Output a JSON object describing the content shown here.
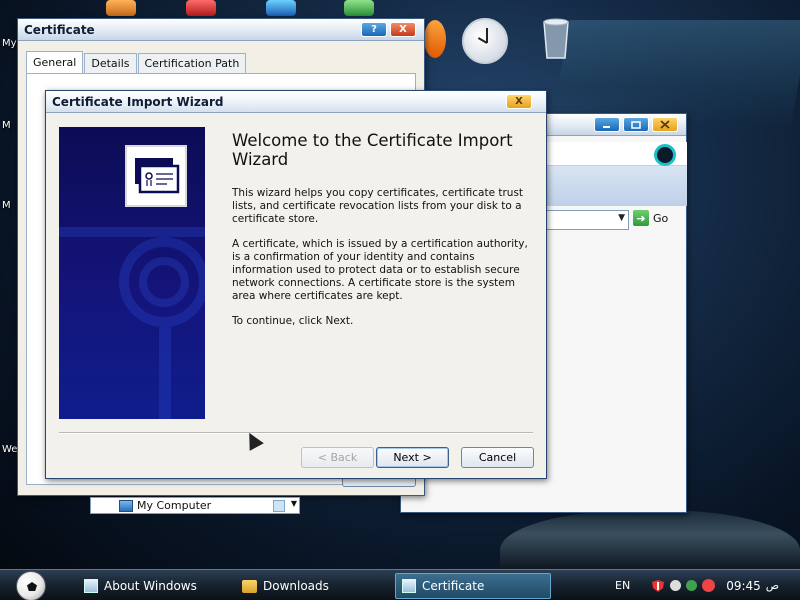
{
  "desktop": {
    "labels": [
      "My",
      "M",
      "M",
      "We"
    ]
  },
  "certificate_window": {
    "title": "Certificate",
    "help_btn": "?",
    "close_btn": "X",
    "tabs": [
      "General",
      "Details",
      "Certification Path"
    ],
    "active_tab": "General"
  },
  "explorer_window": {
    "go_label": "Go",
    "location": "My Computer"
  },
  "wizard": {
    "title": "Certificate Import Wizard",
    "close_btn": "X",
    "heading": "Welcome to the Certificate Import Wizard",
    "paragraphs": [
      "This wizard helps you copy certificates, certificate trust lists, and certificate revocation lists from your disk to a certificate store.",
      "A certificate, which is issued by a certification authority, is a confirmation of your identity and contains information used to protect data or to establish secure network connections. A certificate store is the system area where certificates are kept.",
      "To continue, click Next."
    ],
    "buttons": {
      "back": "< Back",
      "next": "Next >",
      "cancel": "Cancel"
    }
  },
  "taskbar": {
    "tasks": [
      {
        "label": "About Windows",
        "icon": "window-icon"
      },
      {
        "label": "Downloads",
        "icon": "folder-icon"
      },
      {
        "label": "Certificate",
        "icon": "certificate-icon"
      }
    ],
    "language": "EN",
    "clock": "09:45",
    "ampm": "ص"
  },
  "colors": {
    "wizard_side": "#14147a",
    "taskbar": "#17232f",
    "accent_blue": "#3a5a83"
  }
}
